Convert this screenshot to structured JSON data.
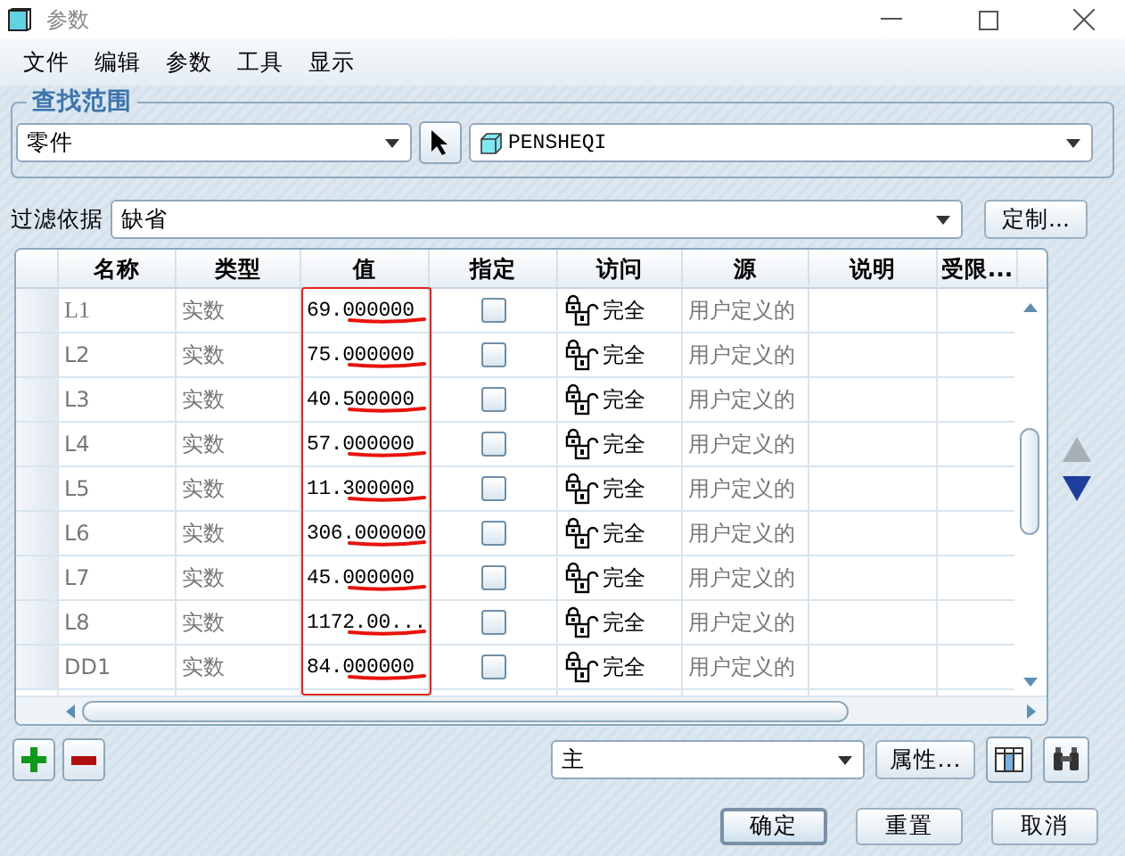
{
  "window": {
    "title": "参数"
  },
  "menu": [
    "文件",
    "编辑",
    "参数",
    "工具",
    "显示"
  ],
  "search_scope": {
    "title": "查找范围",
    "scope": "零件",
    "model": "PENSHEQI"
  },
  "filter": {
    "label": "过滤依据",
    "value": "缺省",
    "button": "定制..."
  },
  "table": {
    "columns": [
      "名称",
      "类型",
      "值",
      "指定",
      "访问",
      "源",
      "说明",
      "受限..."
    ],
    "value_column_boxed": true,
    "rows": [
      {
        "name": "L1",
        "type": "实数",
        "value": "69.000000",
        "designated": false,
        "access": "完全",
        "source": "用户定义的",
        "underlined": true
      },
      {
        "name": "L2",
        "type": "实数",
        "value": "75.000000",
        "designated": false,
        "access": "完全",
        "source": "用户定义的",
        "underlined": true
      },
      {
        "name": "L3",
        "type": "实数",
        "value": "40.500000",
        "designated": false,
        "access": "完全",
        "source": "用户定义的",
        "underlined": true
      },
      {
        "name": "L4",
        "type": "实数",
        "value": "57.000000",
        "designated": false,
        "access": "完全",
        "source": "用户定义的",
        "underlined": true
      },
      {
        "name": "L5",
        "type": "实数",
        "value": "11.300000",
        "designated": false,
        "access": "完全",
        "source": "用户定义的",
        "underlined": true
      },
      {
        "name": "L6",
        "type": "实数",
        "value": "306.000000",
        "designated": false,
        "access": "完全",
        "source": "用户定义的",
        "underlined": true
      },
      {
        "name": "L7",
        "type": "实数",
        "value": "45.000000",
        "designated": false,
        "access": "完全",
        "source": "用户定义的",
        "underlined": true
      },
      {
        "name": "L8",
        "type": "实数",
        "value": "1172.00...",
        "designated": false,
        "access": "完全",
        "source": "用户定义的",
        "underlined": true
      },
      {
        "name": "DD1",
        "type": "实数",
        "value": "84.000000",
        "designated": false,
        "access": "完全",
        "source": "用户定义的",
        "underlined": true
      }
    ]
  },
  "bottom": {
    "view": "主",
    "properties": "属性..."
  },
  "buttons": [
    {
      "label": "确定",
      "default": true
    },
    {
      "label": "重置",
      "default": false
    },
    {
      "label": "取消",
      "default": false
    }
  ]
}
